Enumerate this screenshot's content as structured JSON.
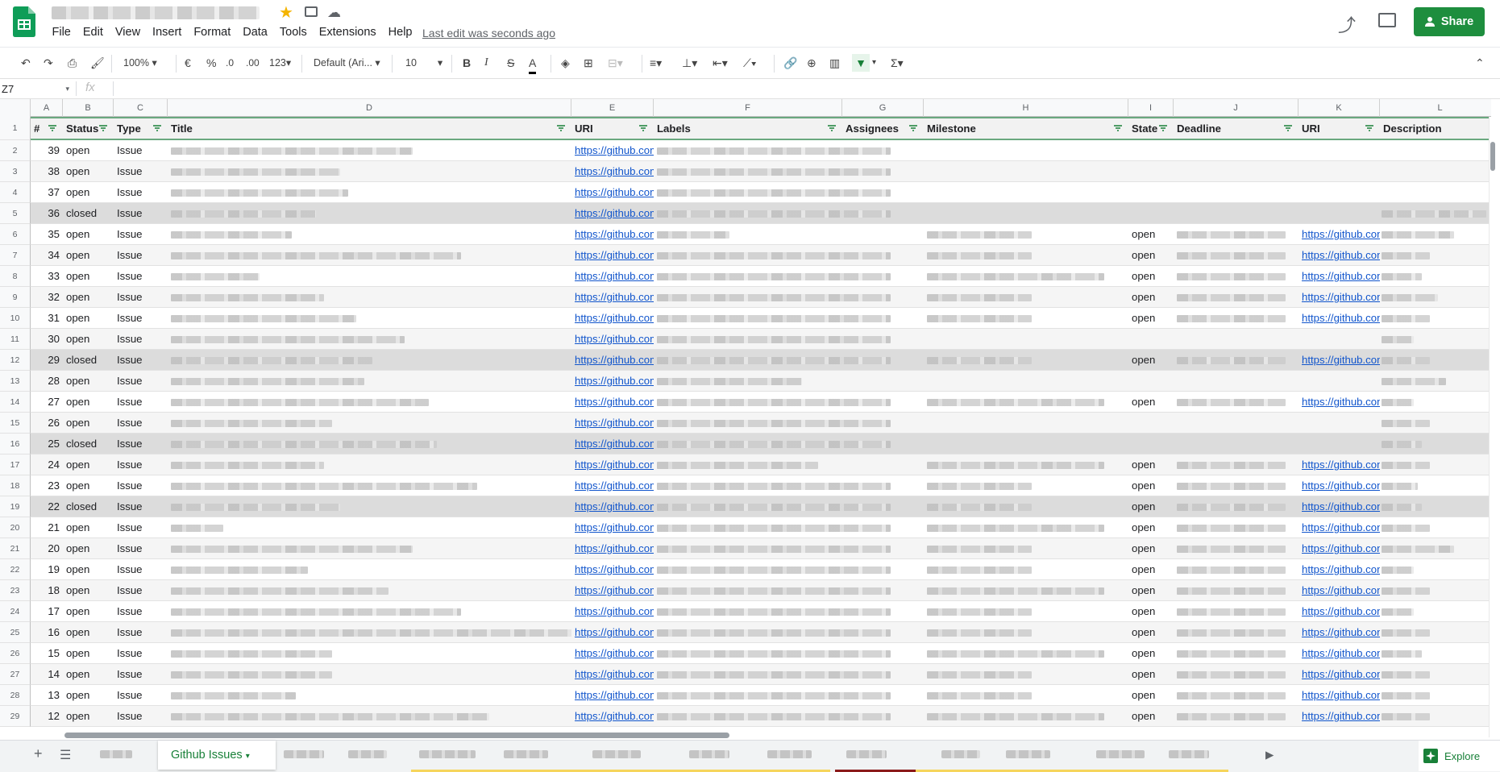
{
  "header": {
    "menu": [
      "File",
      "Edit",
      "View",
      "Insert",
      "Format",
      "Data",
      "Tools",
      "Extensions",
      "Help"
    ],
    "last_edit": "Last edit was seconds ago",
    "share_label": "Share"
  },
  "toolbar": {
    "zoom": "100%",
    "currency": "€",
    "percent": "%",
    "dec_less": ".0",
    "dec_more": ".00",
    "format_more": "123",
    "font": "Default (Ari...",
    "font_size": "10",
    "bold": "B",
    "italic": "I",
    "strike": "S",
    "text_color": "A",
    "sum": "Σ"
  },
  "formula_bar": {
    "name_box": "Z7",
    "fx": "fx"
  },
  "columns": [
    "A",
    "B",
    "C",
    "D",
    "E",
    "F",
    "G",
    "H",
    "I",
    "J",
    "K",
    "L"
  ],
  "headers": [
    "#",
    "Status",
    "Type",
    "Title",
    "URI",
    "Labels",
    "Assignees",
    "Milestone",
    "State",
    "Deadline",
    "URI",
    "Description"
  ],
  "rows": [
    {
      "r": "2",
      "num": "39",
      "status": "open",
      "type": "Issue",
      "uri": "https://github.com",
      "state": "",
      "uri2": ""
    },
    {
      "r": "3",
      "num": "38",
      "status": "open",
      "type": "Issue",
      "uri": "https://github.com",
      "state": "",
      "uri2": ""
    },
    {
      "r": "4",
      "num": "37",
      "status": "open",
      "type": "Issue",
      "uri": "https://github.com",
      "state": "",
      "uri2": ""
    },
    {
      "r": "5",
      "num": "36",
      "status": "closed",
      "type": "Issue",
      "uri": "https://github.com",
      "state": "",
      "uri2": ""
    },
    {
      "r": "6",
      "num": "35",
      "status": "open",
      "type": "Issue",
      "uri": "https://github.com",
      "state": "open",
      "uri2": "https://github.com"
    },
    {
      "r": "7",
      "num": "34",
      "status": "open",
      "type": "Issue",
      "uri": "https://github.com",
      "state": "open",
      "uri2": "https://github.com"
    },
    {
      "r": "8",
      "num": "33",
      "status": "open",
      "type": "Issue",
      "uri": "https://github.com",
      "state": "open",
      "uri2": "https://github.com"
    },
    {
      "r": "9",
      "num": "32",
      "status": "open",
      "type": "Issue",
      "uri": "https://github.com",
      "state": "open",
      "uri2": "https://github.com"
    },
    {
      "r": "10",
      "num": "31",
      "status": "open",
      "type": "Issue",
      "uri": "https://github.com",
      "state": "open",
      "uri2": "https://github.com"
    },
    {
      "r": "11",
      "num": "30",
      "status": "open",
      "type": "Issue",
      "uri": "https://github.com",
      "state": "",
      "uri2": ""
    },
    {
      "r": "12",
      "num": "29",
      "status": "closed",
      "type": "Issue",
      "uri": "https://github.com",
      "state": "open",
      "uri2": "https://github.com"
    },
    {
      "r": "13",
      "num": "28",
      "status": "open",
      "type": "Issue",
      "uri": "https://github.com",
      "state": "",
      "uri2": ""
    },
    {
      "r": "14",
      "num": "27",
      "status": "open",
      "type": "Issue",
      "uri": "https://github.com",
      "state": "open",
      "uri2": "https://github.com"
    },
    {
      "r": "15",
      "num": "26",
      "status": "open",
      "type": "Issue",
      "uri": "https://github.com",
      "state": "",
      "uri2": ""
    },
    {
      "r": "16",
      "num": "25",
      "status": "closed",
      "type": "Issue",
      "uri": "https://github.com",
      "state": "",
      "uri2": ""
    },
    {
      "r": "17",
      "num": "24",
      "status": "open",
      "type": "Issue",
      "uri": "https://github.com",
      "state": "open",
      "uri2": "https://github.com"
    },
    {
      "r": "18",
      "num": "23",
      "status": "open",
      "type": "Issue",
      "uri": "https://github.com",
      "state": "open",
      "uri2": "https://github.com"
    },
    {
      "r": "19",
      "num": "22",
      "status": "closed",
      "type": "Issue",
      "uri": "https://github.com",
      "state": "open",
      "uri2": "https://github.com"
    },
    {
      "r": "20",
      "num": "21",
      "status": "open",
      "type": "Issue",
      "uri": "https://github.com",
      "state": "open",
      "uri2": "https://github.com"
    },
    {
      "r": "21",
      "num": "20",
      "status": "open",
      "type": "Issue",
      "uri": "https://github.com",
      "state": "open",
      "uri2": "https://github.com"
    },
    {
      "r": "22",
      "num": "19",
      "status": "open",
      "type": "Issue",
      "uri": "https://github.com",
      "state": "open",
      "uri2": "https://github.com"
    },
    {
      "r": "23",
      "num": "18",
      "status": "open",
      "type": "Issue",
      "uri": "https://github.com",
      "state": "open",
      "uri2": "https://github.com"
    },
    {
      "r": "24",
      "num": "17",
      "status": "open",
      "type": "Issue",
      "uri": "https://github.com",
      "state": "open",
      "uri2": "https://github.com"
    },
    {
      "r": "25",
      "num": "16",
      "status": "open",
      "type": "Issue",
      "uri": "https://github.com",
      "state": "open",
      "uri2": "https://github.com"
    },
    {
      "r": "26",
      "num": "15",
      "status": "open",
      "type": "Issue",
      "uri": "https://github.com",
      "state": "open",
      "uri2": "https://github.com"
    },
    {
      "r": "27",
      "num": "14",
      "status": "open",
      "type": "Issue",
      "uri": "https://github.com",
      "state": "open",
      "uri2": "https://github.com"
    },
    {
      "r": "28",
      "num": "13",
      "status": "open",
      "type": "Issue",
      "uri": "https://github.com",
      "state": "open",
      "uri2": "https://github.com"
    },
    {
      "r": "29",
      "num": "12",
      "status": "open",
      "type": "Issue",
      "uri": "https://github.com",
      "state": "open",
      "uri2": "https://github.com"
    }
  ],
  "sheets": {
    "active": "Github Issues"
  },
  "explore_label": "Explore",
  "colors": {
    "accent": "#188038",
    "share": "#1e8e3e",
    "link": "#1155cc",
    "closed_row": "#dcdcdc"
  }
}
